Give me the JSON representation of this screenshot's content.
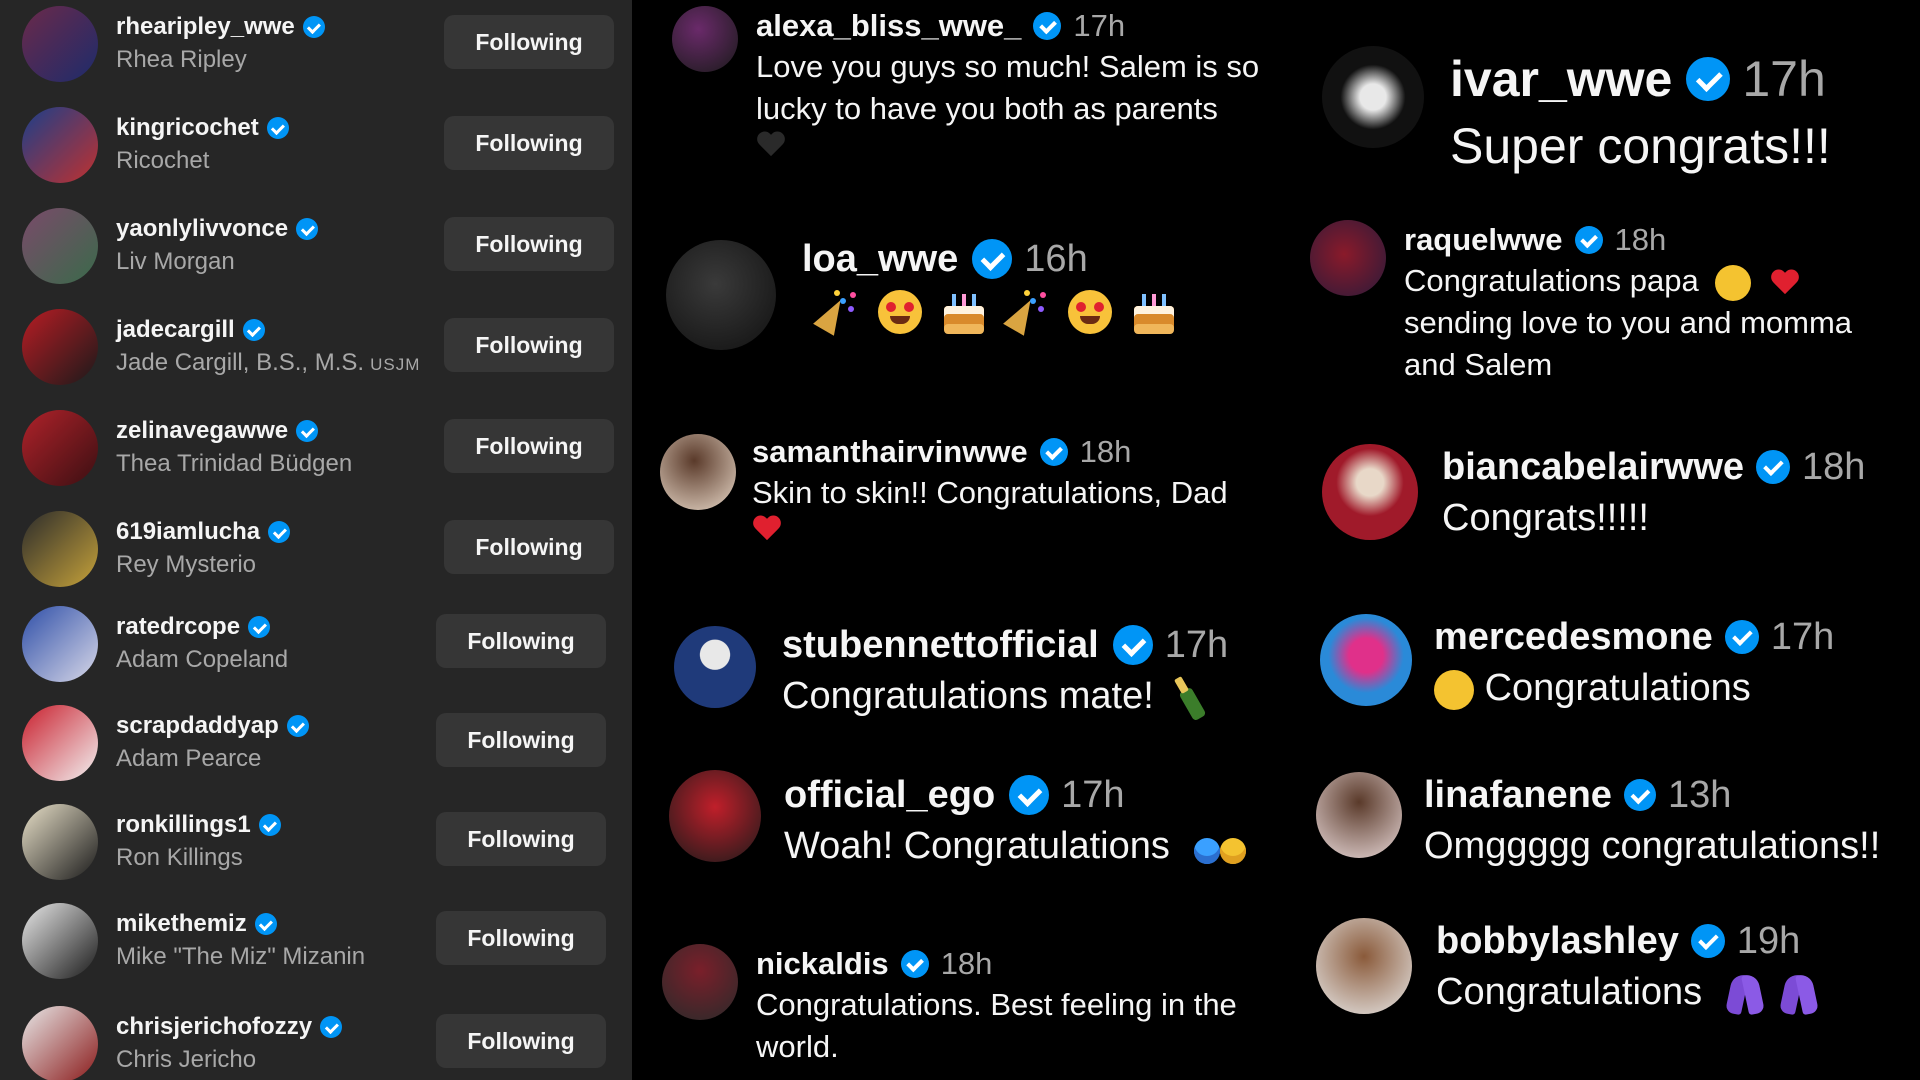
{
  "following": [
    {
      "username": "rhearipley_wwe",
      "name": "Rhea Ripley",
      "button": "Following",
      "avatar_colors": [
        "#6b2a4a",
        "#1d2b6b"
      ]
    },
    {
      "username": "kingricochet",
      "name": "Ricochet",
      "button": "Following",
      "avatar_colors": [
        "#1b3f8a",
        "#c0312f"
      ]
    },
    {
      "username": "yaonlylivvonce",
      "name": "Liv Morgan",
      "button": "Following",
      "avatar_colors": [
        "#7a4a6a",
        "#3a6a4a"
      ]
    },
    {
      "username": "jadecargill",
      "name": "Jade Cargill, B.S., M.S.",
      "name_suffix": "USJM",
      "button": "Following",
      "avatar_colors": [
        "#b81c24",
        "#1a1a1a"
      ]
    },
    {
      "username": "zelinavegawwe",
      "name": "Thea Trinidad Büdgen",
      "button": "Following",
      "avatar_colors": [
        "#b0222a",
        "#3a0f12"
      ]
    },
    {
      "username": "619iamlucha",
      "name": "Rey Mysterio",
      "button": "Following",
      "avatar_colors": [
        "#2b2b2b",
        "#c6a23a"
      ]
    },
    {
      "username": "ratedrcope",
      "name": "Adam Copeland",
      "button": "Following",
      "avatar_colors": [
        "#2f4fa8",
        "#d8d8e8"
      ]
    },
    {
      "username": "scrapdaddyap",
      "name": "Adam Pearce",
      "button": "Following",
      "avatar_colors": [
        "#c91f2d",
        "#f2f2f2"
      ]
    },
    {
      "username": "ronkillings1",
      "name": "Ron Killings",
      "button": "Following",
      "avatar_colors": [
        "#e8e0c8",
        "#1a1a1a"
      ]
    },
    {
      "username": "mikethemiz",
      "name": "Mike \"The Miz\" Mizanin",
      "button": "Following",
      "avatar_colors": [
        "#e8e8e8",
        "#1a1a1a"
      ]
    },
    {
      "username": "chrisjerichofozzy",
      "name": "Chris Jericho",
      "button": "Following",
      "avatar_colors": [
        "#e8e8e8",
        "#8a1a1a"
      ]
    }
  ],
  "comments_left": [
    {
      "username": "alexa_bliss_wwe_",
      "time": "17h",
      "text": "Love you guys so much! Salem is so lucky to have you both as parents",
      "avatar_colors": [
        "#6a2a6a",
        "#1a1a1a"
      ]
    },
    {
      "username": "loa_wwe",
      "time": "16h",
      "text": "",
      "emojis": [
        "party-popper",
        "partying-face",
        "birthday-cake",
        "party-popper",
        "partying-face",
        "birthday-cake"
      ],
      "avatar_colors": [
        "#3a3a3a",
        "#101010"
      ]
    },
    {
      "username": "samanthairvinwwe",
      "time": "18h",
      "text": "Skin to skin!! Congratulations, Dad",
      "avatar_colors": [
        "#5a3a2a",
        "#e8d8c8"
      ]
    },
    {
      "username": "stubennettofficial",
      "time": "17h",
      "text": "Congratulations mate!",
      "avatar_colors": [
        "#1f3a7a",
        "#e8e8e8"
      ]
    },
    {
      "username": "official_ego",
      "time": "17h",
      "text": "Woah! Congratulations",
      "avatar_colors": [
        "#c01f2a",
        "#1a1a1a"
      ]
    },
    {
      "username": "nickaldis",
      "time": "18h",
      "text": "Congratulations. Best feeling in the world.",
      "avatar_colors": [
        "#7a1f2a",
        "#2a2a2a"
      ]
    }
  ],
  "comments_right": [
    {
      "username": "ivar_wwe",
      "time": "17h",
      "text": "Super congrats!!!",
      "avatar_colors": [
        "#e8e8e8",
        "#111111"
      ]
    },
    {
      "username": "raquelwwe",
      "time": "18h",
      "text": "Congratulations papa",
      "text_line2": "sending love to you and momma and Salem",
      "avatar_colors": [
        "#8a1a2a",
        "#2a1a3a"
      ]
    },
    {
      "username": "biancabelairwwe",
      "time": "18h",
      "text": "Congrats!!!!!",
      "avatar_colors": [
        "#a01a2a",
        "#e8d8c8"
      ]
    },
    {
      "username": "mercedesmone",
      "time": "17h",
      "text": "Congratulations",
      "avatar_colors": [
        "#2a8ad8",
        "#e0308a"
      ]
    },
    {
      "username": "linafanene",
      "time": "13h",
      "text": "Omggggg congratulations!!",
      "avatar_colors": [
        "#5a3a2a",
        "#e8d8d8"
      ]
    },
    {
      "username": "bobbylashley",
      "time": "19h",
      "text": "Congratulations",
      "avatar_colors": [
        "#8a5a3a",
        "#e8e8e8"
      ]
    }
  ],
  "colors": {
    "panel_bg": "#262626",
    "button_bg": "#363636",
    "verified": "#0095f6",
    "secondary_text": "#a8a8a8",
    "background": "#000000"
  }
}
